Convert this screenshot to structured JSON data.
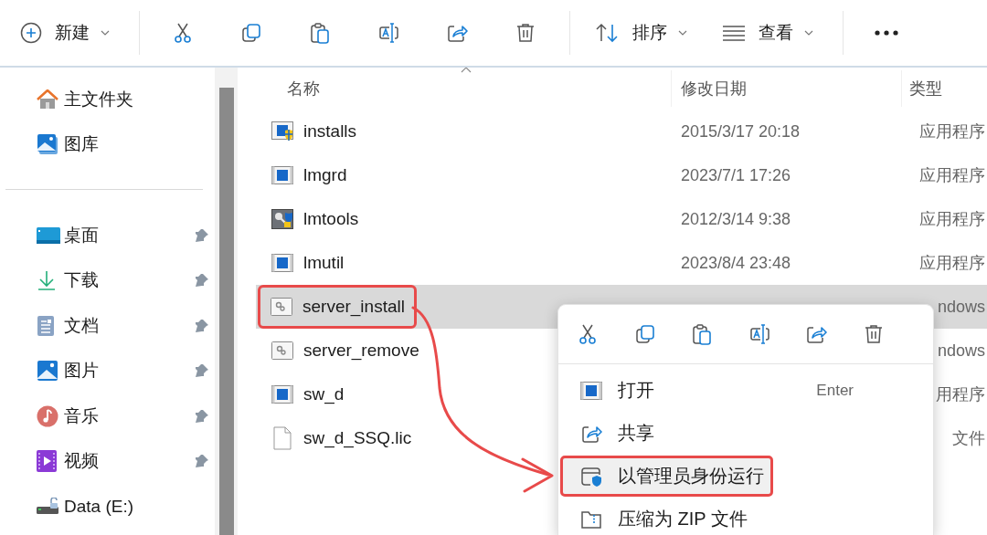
{
  "toolbar": {
    "items": [
      {
        "kind": "new",
        "label": "新建",
        "dropdown": true
      },
      {
        "kind": "separator"
      },
      {
        "kind": "cut"
      },
      {
        "kind": "copy"
      },
      {
        "kind": "paste"
      },
      {
        "kind": "rename"
      },
      {
        "kind": "share"
      },
      {
        "kind": "delete"
      },
      {
        "kind": "separator"
      },
      {
        "kind": "sort",
        "label": "排序",
        "dropdown": true
      },
      {
        "kind": "view",
        "label": "查看",
        "dropdown": true
      },
      {
        "kind": "separator"
      },
      {
        "kind": "more"
      }
    ]
  },
  "sidebar": {
    "sections": [
      [
        {
          "label": "主文件夹",
          "kind": "home",
          "pinned": false
        },
        {
          "label": "图库",
          "kind": "gallery",
          "pinned": false
        }
      ],
      [
        {
          "label": "桌面",
          "kind": "desktop",
          "pinned": true
        },
        {
          "label": "下载",
          "kind": "download",
          "pinned": true
        },
        {
          "label": "文档",
          "kind": "document",
          "pinned": true
        },
        {
          "label": "图片",
          "kind": "pictures",
          "pinned": true
        },
        {
          "label": "音乐",
          "kind": "music",
          "pinned": true
        },
        {
          "label": "视频",
          "kind": "video",
          "pinned": true
        },
        {
          "label": "Data (E:)",
          "kind": "drive",
          "pinned": false
        }
      ]
    ]
  },
  "table": {
    "columns": [
      {
        "label": "名称",
        "sorted": true
      },
      {
        "label": "修改日期",
        "sorted": false
      },
      {
        "label": "类型",
        "sorted": false
      }
    ],
    "rows": [
      {
        "name": "installs",
        "date": "2015/3/17 20:18",
        "type": "应用程序",
        "kind": "app-shield",
        "selected": false,
        "outlined": false
      },
      {
        "name": "lmgrd",
        "date": "2023/7/1 17:26",
        "type": "应用程序",
        "kind": "app",
        "selected": false,
        "outlined": false
      },
      {
        "name": "lmtools",
        "date": "2012/3/14 9:38",
        "type": "应用程序",
        "kind": "tools",
        "selected": false,
        "outlined": false
      },
      {
        "name": "lmutil",
        "date": "2023/8/4 23:48",
        "type": "应用程序",
        "kind": "app",
        "selected": false,
        "outlined": false
      },
      {
        "name": "server_install",
        "type": "ndows",
        "kind": "batch",
        "selected": true,
        "outlined": true
      },
      {
        "name": "server_remove",
        "type": "ndows",
        "kind": "batch",
        "selected": false,
        "outlined": false
      },
      {
        "name": "sw_d",
        "type": "用程序",
        "kind": "app",
        "selected": false,
        "outlined": false
      },
      {
        "name": "sw_d_SSQ.lic",
        "type": "文件",
        "kind": "file",
        "selected": false,
        "outlined": false
      }
    ]
  },
  "context_menu": {
    "actions": [
      {
        "kind": "cut"
      },
      {
        "kind": "copy"
      },
      {
        "kind": "paste"
      },
      {
        "kind": "rename"
      },
      {
        "kind": "share"
      },
      {
        "kind": "delete"
      }
    ],
    "items": [
      {
        "label": "打开",
        "shortcut": "Enter",
        "kind": "open",
        "selected": false,
        "outlined": false
      },
      {
        "label": "共享",
        "kind": "share",
        "selected": false,
        "outlined": false
      },
      {
        "label": "以管理员身份运行",
        "kind": "admin",
        "selected": true,
        "outlined": true
      },
      {
        "label": "压缩为 ZIP 文件",
        "kind": "zip",
        "selected": false,
        "outlined": false
      }
    ]
  },
  "annotation": {
    "kind": "arrow",
    "color": "#e84a4a"
  }
}
